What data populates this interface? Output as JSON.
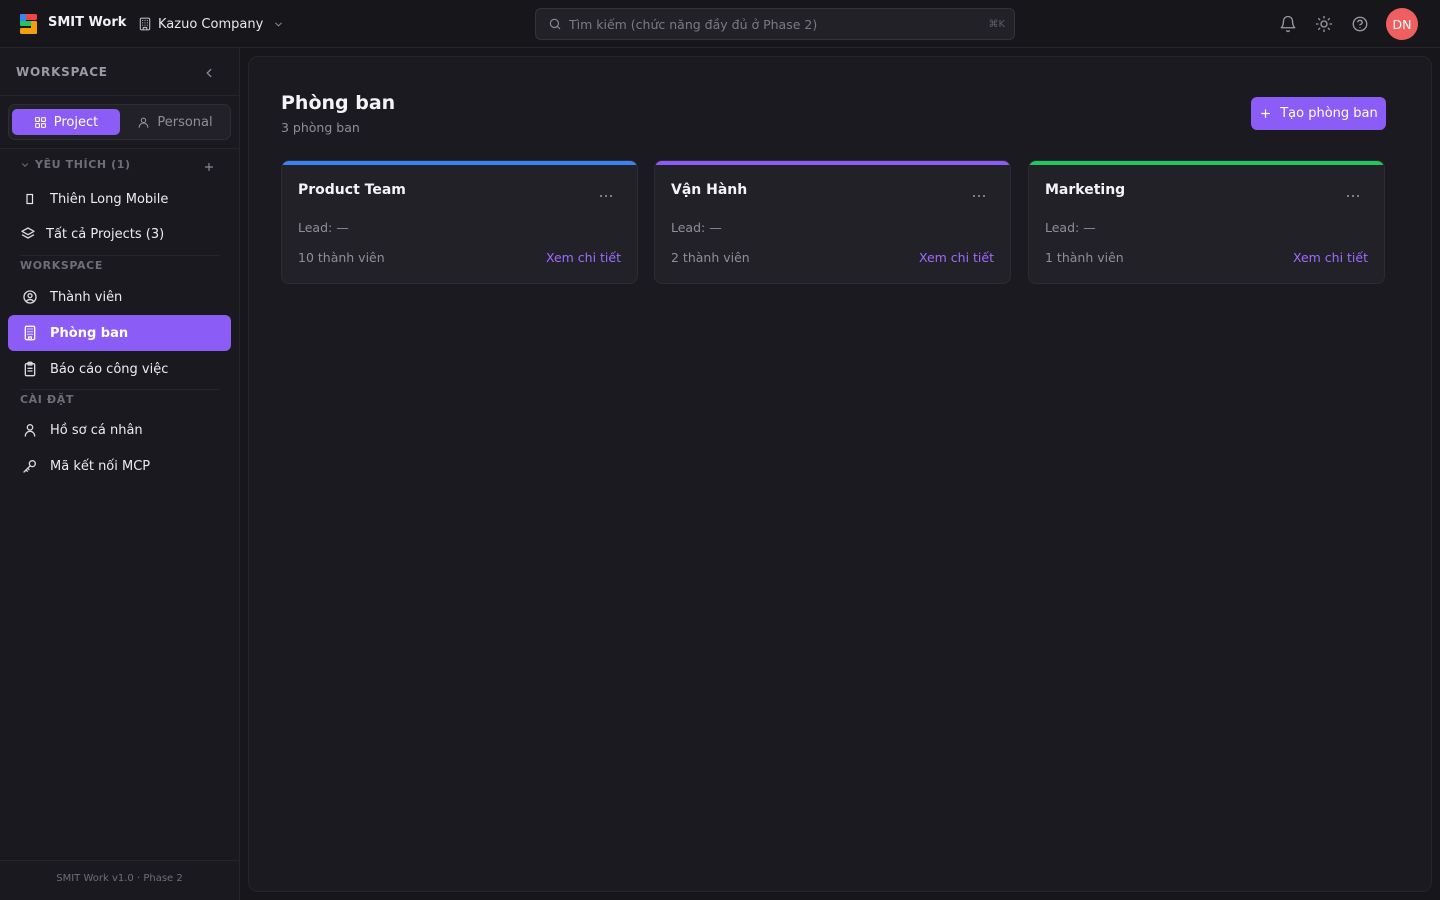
{
  "topbar": {
    "app_title": "SMIT Work",
    "company": "Kazuo Company",
    "search_placeholder": "Tìm kiếm (chức năng đầy đủ ở Phase 2)",
    "search_shortcut": "⌘K",
    "avatar_initials": "DN",
    "avatar_color": "#ef5f5f"
  },
  "sidebar": {
    "header": "WORKSPACE",
    "toggle": {
      "project": "Project",
      "personal": "Personal"
    },
    "favorites_header": "YÊU THÍCH (1)",
    "favorites": [
      {
        "label": "Thiên Long Mobile",
        "icon": "square-icon"
      },
      {
        "label": "Tất cả Projects (3)",
        "icon": "layers-icon"
      }
    ],
    "workspace_header": "WORKSPACE",
    "workspace_items": [
      {
        "label": "Thành viên",
        "icon": "user-circle-icon"
      },
      {
        "label": "Phòng ban",
        "icon": "building-icon",
        "active": true
      },
      {
        "label": "Báo cáo công việc",
        "icon": "clipboard-icon"
      }
    ],
    "settings_header": "CÀI ĐẶT",
    "settings_items": [
      {
        "label": "Hồ sơ cá nhân",
        "icon": "user-icon"
      },
      {
        "label": "Mã kết nối MCP",
        "icon": "key-icon"
      }
    ],
    "footer": "SMIT Work v1.0 · Phase 2"
  },
  "main": {
    "title": "Phòng ban",
    "subtitle": "3 phòng ban",
    "create_button": "Tạo phòng ban",
    "departments": [
      {
        "name": "Product Team",
        "lead": "Lead: —",
        "members": "10 thành viên",
        "link": "Xem chi tiết",
        "color": "#3b82f6"
      },
      {
        "name": "Vận Hành",
        "lead": "Lead: —",
        "members": "2 thành viên",
        "link": "Xem chi tiết",
        "color": "#8b5cf6"
      },
      {
        "name": "Marketing",
        "lead": "Lead: —",
        "members": "1 thành viên",
        "link": "Xem chi tiết",
        "color": "#22c55e"
      }
    ]
  },
  "colors": {
    "accent": "#8b5cf6",
    "background": "#17161b",
    "link": "#9d6cff"
  }
}
